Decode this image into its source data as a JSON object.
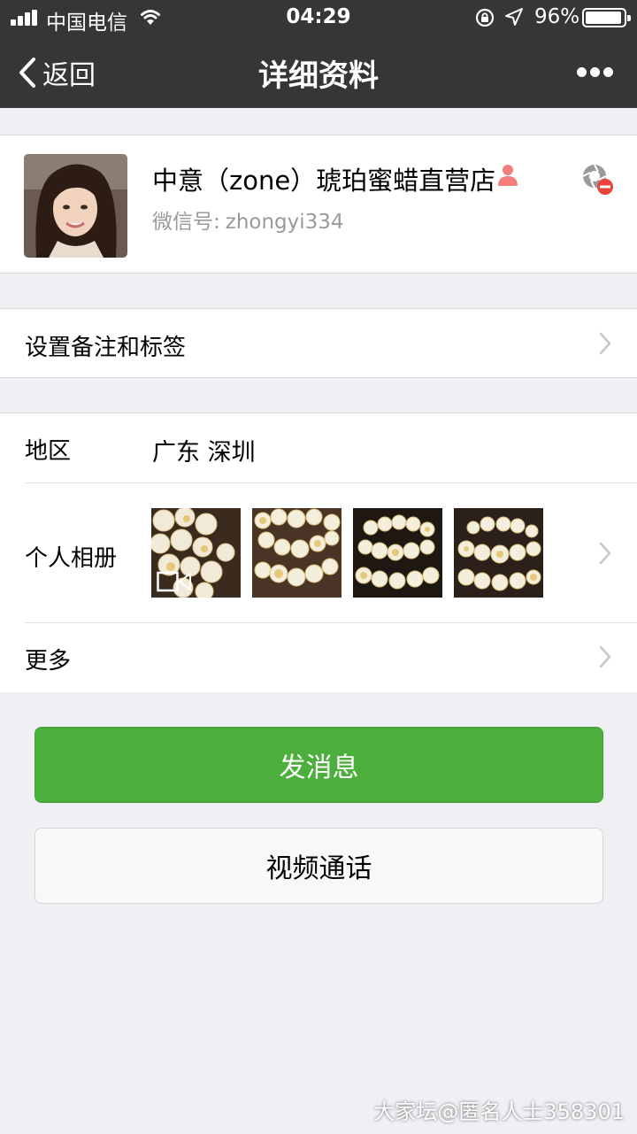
{
  "status_bar": {
    "carrier": "中国电信",
    "time": "04:29",
    "battery_percent": "96%",
    "battery_level": 0.96
  },
  "nav": {
    "back_label": "返回",
    "title": "详细资料",
    "more_icon": "more-dots-icon"
  },
  "profile": {
    "name": "中意（zone）琥珀蜜蜡直营店",
    "wechat_id_label": "微信号:",
    "wechat_id": "zhongyi334",
    "gender_icon": "female-icon",
    "gender_color": "#f37e7d",
    "mute_icon": "camera-shutter-blocked-icon"
  },
  "remark_row": {
    "label": "设置备注和标签"
  },
  "details": {
    "region_label": "地区",
    "region_value": "广东 深圳",
    "album_label": "个人相册",
    "album_photo_count": 4,
    "album_first_is_video": true,
    "more_label": "更多"
  },
  "buttons": {
    "send_message": "发消息",
    "video_call": "视频通话"
  },
  "colors": {
    "topbar": "#363636",
    "background": "#efeff4",
    "primary_button": "#4cae3c",
    "badge_red": "#e8443a"
  },
  "watermark": "大家坛@匿名人士358301"
}
